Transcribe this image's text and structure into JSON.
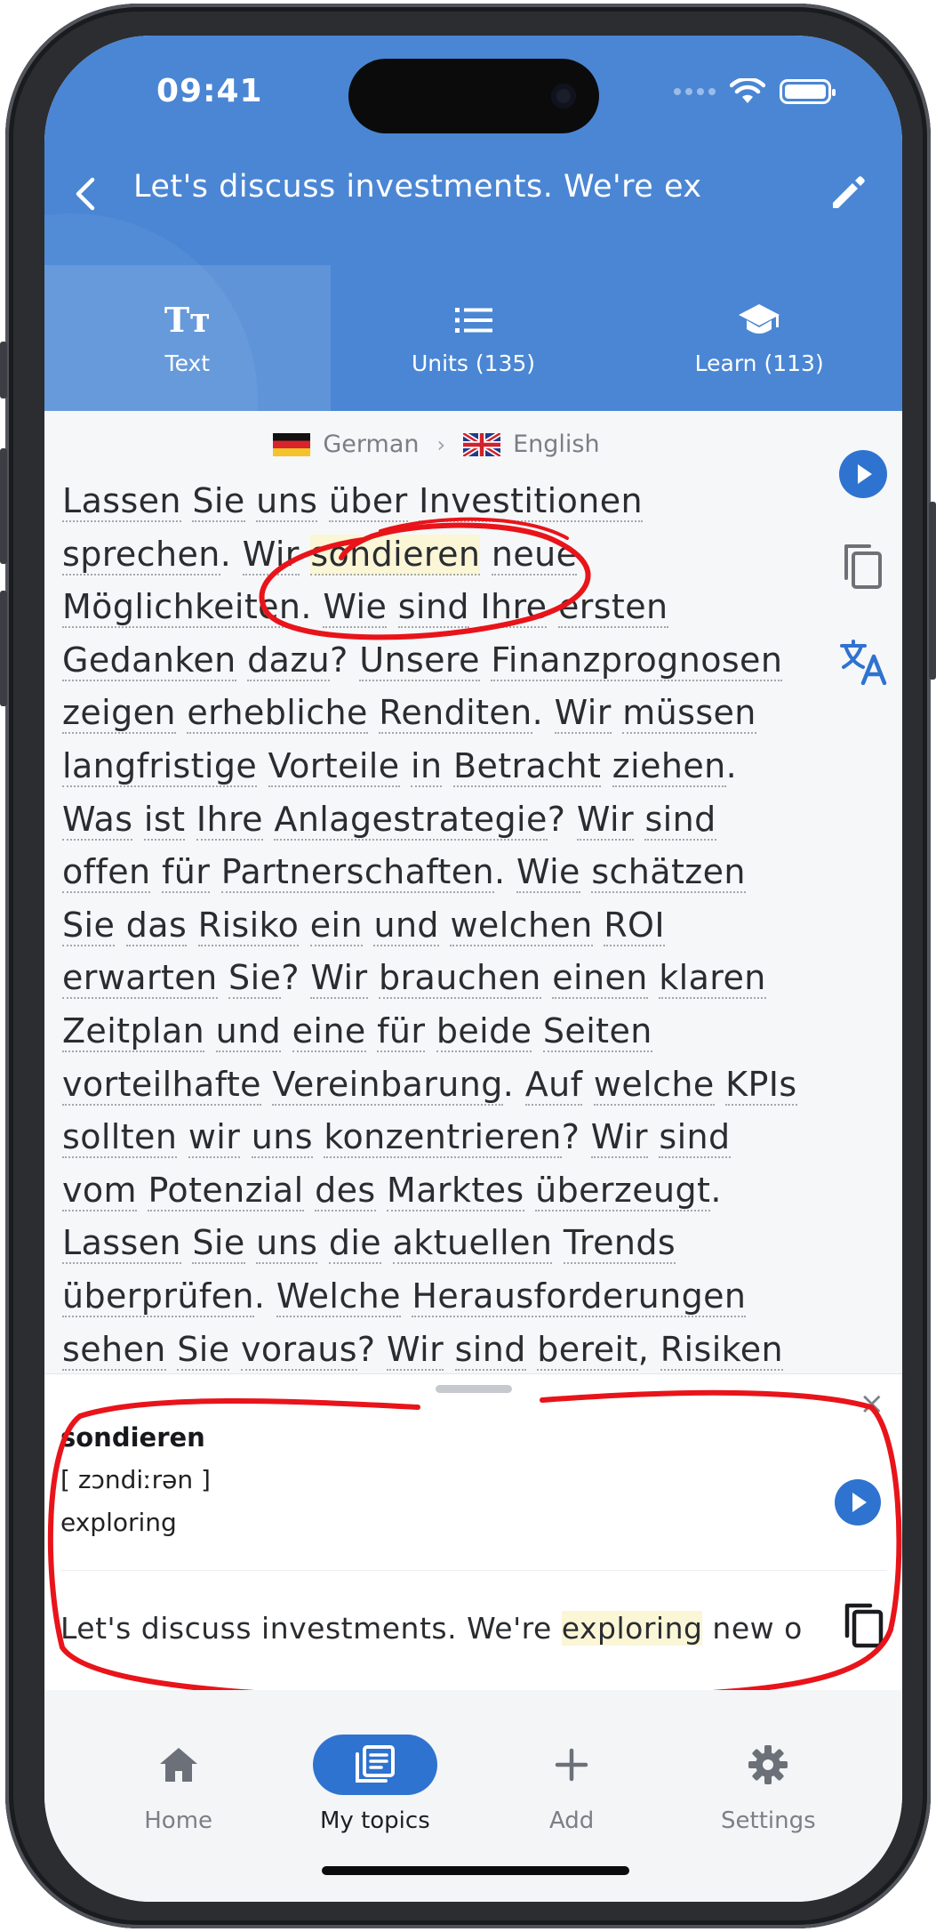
{
  "status_bar": {
    "time": "09:41"
  },
  "header": {
    "title": "Let's discuss investments. We're ex",
    "tabs": [
      {
        "label": "Text",
        "icon": "text-format-icon",
        "active": true
      },
      {
        "label": "Units (135)",
        "icon": "list-icon",
        "active": false
      },
      {
        "label": "Learn (113)",
        "icon": "graduation-cap-icon",
        "active": false
      }
    ]
  },
  "language_pair": {
    "source": "German",
    "target": "English"
  },
  "reading": {
    "text_lines": [
      "Lassen Sie uns über Investitionen",
      "sprechen. Wir sondieren neue",
      "Möglichkeiten. Wie sind Ihre ersten",
      "Gedanken dazu? Unsere Finanzprognosen",
      "zeigen erhebliche Renditen. Wir müssen",
      "langfristige Vorteile in Betracht ziehen.",
      "Was ist Ihre Anlagestrategie? Wir sind",
      "offen für Partnerschaften. Wie schätzen",
      "Sie das Risiko ein und welchen ROI",
      "erwarten Sie? Wir brauchen einen klaren",
      "Zeitplan und eine für beide Seiten",
      "vorteilhafte Vereinbarung. Auf welche KPIs",
      "sollten wir uns konzentrieren? Wir sind",
      "vom Potenzial des Marktes überzeugt.",
      "Lassen Sie uns die aktuellen Trends",
      "überprüfen. Welche Herausforderungen",
      "sehen Sie voraus? Wir sind bereit, Risiken"
    ],
    "selected_word": "sondieren"
  },
  "word_sheet": {
    "word": "sondieren",
    "phonetic": "[ zɔndiːrən ]",
    "meaning": "exploring",
    "sentence_before": "Let's discuss investments. We're ",
    "sentence_highlight": "exploring",
    "sentence_after": " new o"
  },
  "bottom_nav": [
    {
      "label": "Home",
      "icon": "home-icon",
      "active": false
    },
    {
      "label": "My topics",
      "icon": "topics-icon",
      "active": true
    },
    {
      "label": "Add",
      "icon": "plus-icon",
      "active": false
    },
    {
      "label": "Settings",
      "icon": "gear-icon",
      "active": false
    }
  ],
  "colors": {
    "header": "#4a86d4",
    "accent": "#2f73d0",
    "highlight": "#faf6d6",
    "annotation": "#e8141a"
  }
}
